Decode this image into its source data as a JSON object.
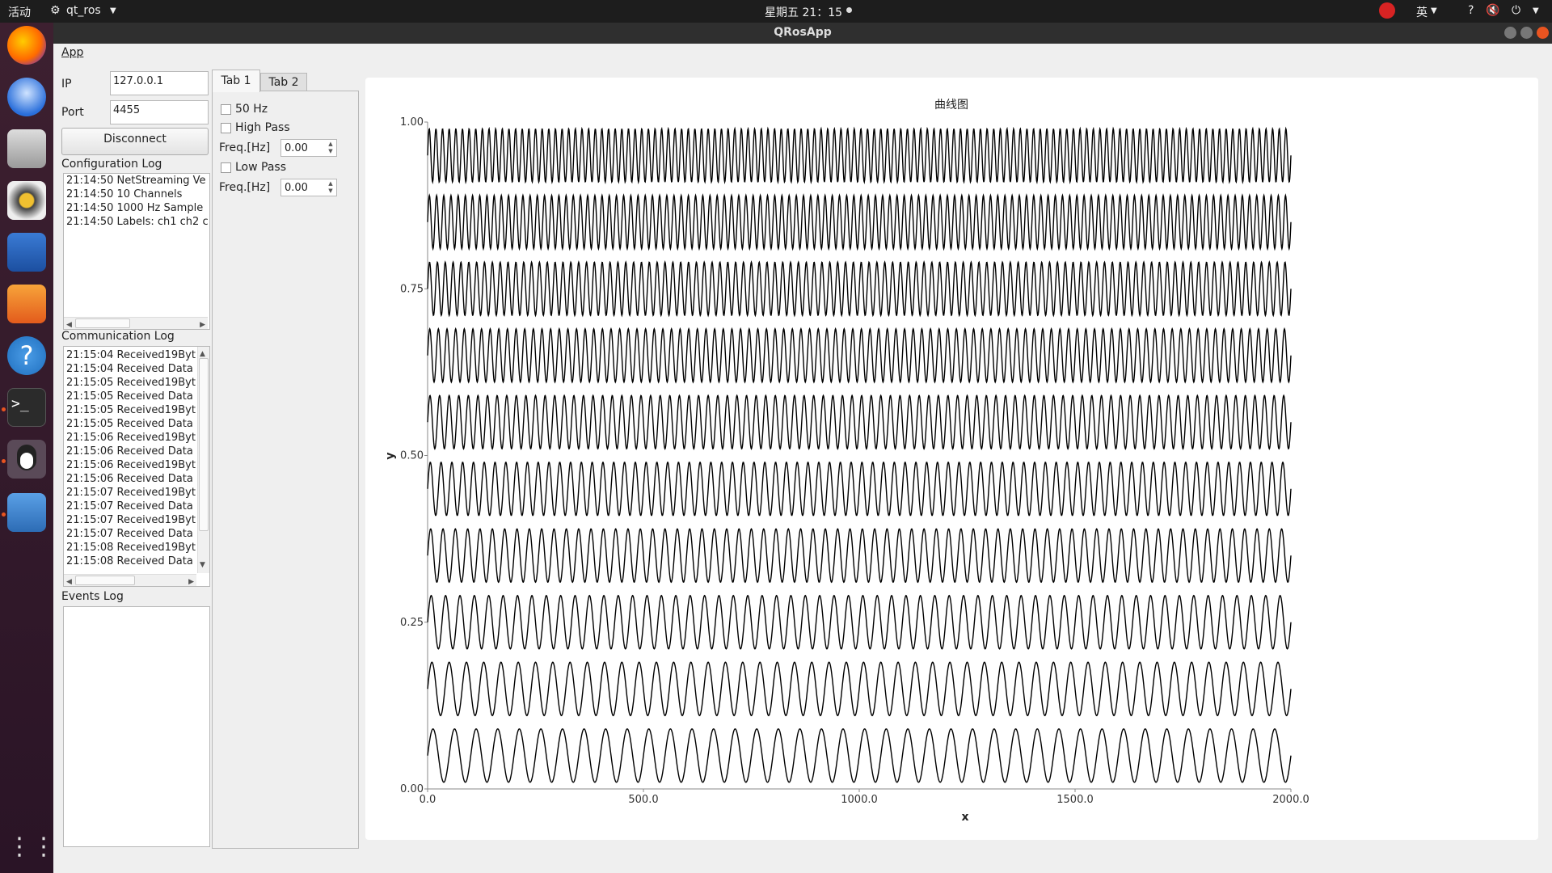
{
  "system_bar": {
    "activities": "活动",
    "app_name": "qt_ros",
    "clock": "星期五 21：15",
    "input_method": "英",
    "help": "?"
  },
  "window": {
    "title": "QRosApp"
  },
  "menu": {
    "app": "App"
  },
  "connection": {
    "ip_label": "IP",
    "ip_value": "127.0.0.1",
    "port_label": "Port",
    "port_value": "4455",
    "disconnect_label": "Disconnect"
  },
  "config_log": {
    "title": "Configuration Log",
    "lines": [
      "21:14:50 NetStreaming Ve",
      "21:14:50 10 Channels",
      "21:14:50 1000 Hz Sample",
      "21:14:50 Labels: ch1 ch2 c"
    ]
  },
  "comm_log": {
    "title": "Communication Log",
    "lines": [
      "21:15:04 Received19Byt",
      "21:15:04 Received Data",
      "21:15:05 Received19Byt",
      "21:15:05 Received Data",
      "21:15:05 Received19Byt",
      "21:15:05 Received Data",
      "21:15:06 Received19Byt",
      "21:15:06 Received Data",
      "21:15:06 Received19Byt",
      "21:15:06 Received Data",
      "21:15:07 Received19Byt",
      "21:15:07 Received Data",
      "21:15:07 Received19Byt",
      "21:15:07 Received Data",
      "21:15:08 Received19Byt",
      "21:15:08 Received Data"
    ]
  },
  "events_log": {
    "title": "Events Log"
  },
  "tabs": [
    {
      "label": "Tab 1"
    },
    {
      "label": "Tab 2"
    }
  ],
  "filters": {
    "notch_label": "50 Hz",
    "highpass_label": "High Pass",
    "highpass_freq_label": "Freq.[Hz]",
    "highpass_freq_value": "0.00",
    "lowpass_label": "Low Pass",
    "lowpass_freq_label": "Freq.[Hz]",
    "lowpass_freq_value": "0.00"
  },
  "colors": {
    "accent": "#e95420",
    "wave": "#000000",
    "dock_top": "#3d2030"
  },
  "chart_data": {
    "type": "line",
    "title": "曲线图",
    "xlabel": "x",
    "ylabel": "y",
    "xlim": [
      0,
      2000
    ],
    "ylim": [
      0,
      1
    ],
    "x_ticks": [
      "0.0",
      "500.0",
      "1000.0",
      "1500.0",
      "2000.0"
    ],
    "y_ticks": [
      "0.00",
      "0.25",
      "0.50",
      "0.75",
      "1.00"
    ],
    "grid": false,
    "series": [
      {
        "offset": 0.05,
        "amplitude": 0.04,
        "cycles": 40
      },
      {
        "offset": 0.15,
        "amplitude": 0.04,
        "cycles": 50
      },
      {
        "offset": 0.25,
        "amplitude": 0.04,
        "cycles": 60
      },
      {
        "offset": 0.35,
        "amplitude": 0.04,
        "cycles": 70
      },
      {
        "offset": 0.45,
        "amplitude": 0.04,
        "cycles": 80
      },
      {
        "offset": 0.55,
        "amplitude": 0.04,
        "cycles": 90
      },
      {
        "offset": 0.65,
        "amplitude": 0.04,
        "cycles": 100
      },
      {
        "offset": 0.75,
        "amplitude": 0.04,
        "cycles": 110
      },
      {
        "offset": 0.85,
        "amplitude": 0.04,
        "cycles": 120
      },
      {
        "offset": 0.95,
        "amplitude": 0.04,
        "cycles": 130
      }
    ]
  }
}
